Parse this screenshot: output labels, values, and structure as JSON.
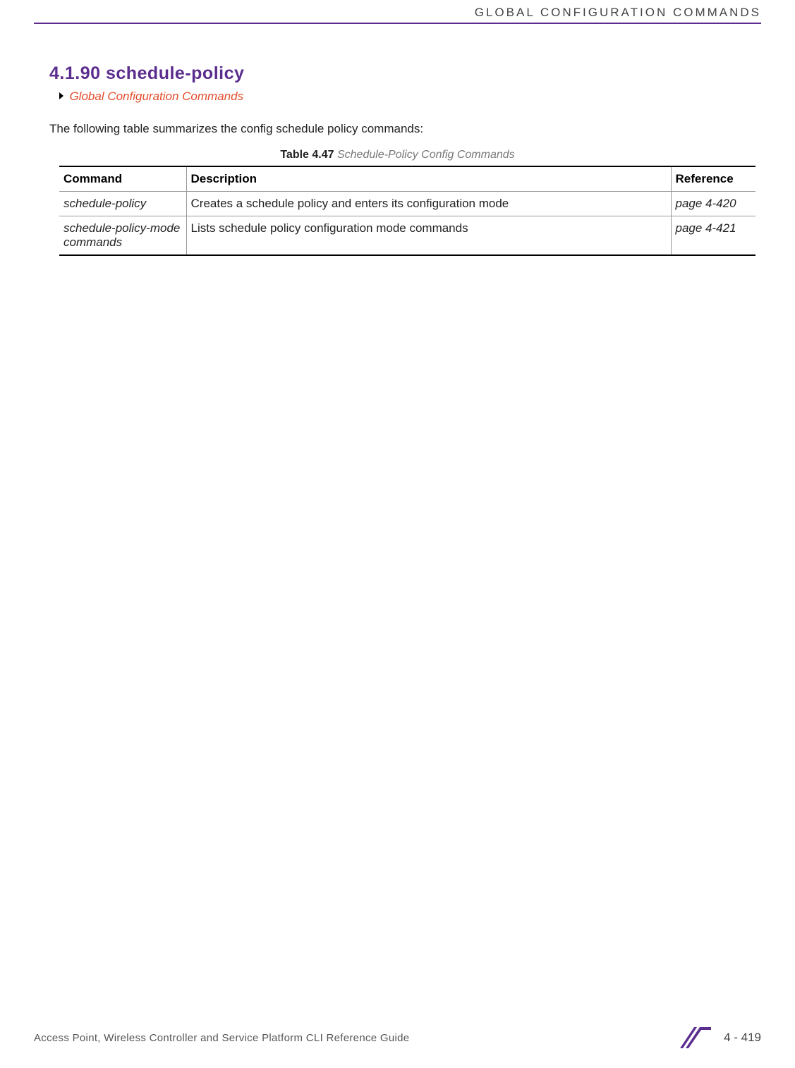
{
  "header": {
    "category": "GLOBAL CONFIGURATION COMMANDS"
  },
  "section": {
    "heading": "4.1.90 schedule-policy",
    "breadcrumb": "Global Configuration Commands",
    "intro": "The following table summarizes the config schedule policy commands:"
  },
  "table": {
    "caption_label": "Table 4.47",
    "caption_title": "Schedule-Policy Config Commands",
    "headers": {
      "command": "Command",
      "description": "Description",
      "reference": "Reference"
    },
    "rows": [
      {
        "command": "schedule-policy",
        "description": "Creates a schedule policy and enters its configuration mode",
        "reference": "page 4-420"
      },
      {
        "command": "schedule-policy-mode commands",
        "description": "Lists schedule policy configuration mode commands",
        "reference": "page 4-421"
      }
    ]
  },
  "footer": {
    "doc_title": "Access Point, Wireless Controller and Service Platform CLI Reference Guide",
    "page_number": "4 - 419"
  }
}
